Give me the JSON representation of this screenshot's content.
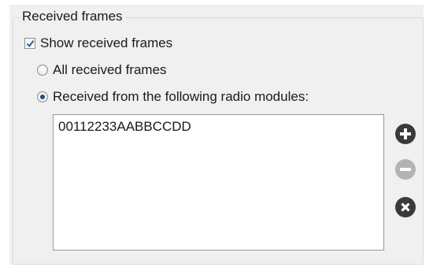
{
  "group": {
    "title": "Received frames"
  },
  "show_received": {
    "label": "Show received frames",
    "checked": true
  },
  "filter": {
    "all_label": "All received frames",
    "from_modules_label": "Received from the following radio modules:",
    "selected": "from_modules"
  },
  "modules_list": {
    "items": [
      "00112233AABBCCDD"
    ]
  },
  "buttons": {
    "add_icon": "plus-circle-icon",
    "remove_icon": "minus-circle-icon",
    "clear_icon": "x-circle-icon",
    "enabled_color": "#3a3a3a",
    "disabled_color": "#b3b3b3"
  }
}
